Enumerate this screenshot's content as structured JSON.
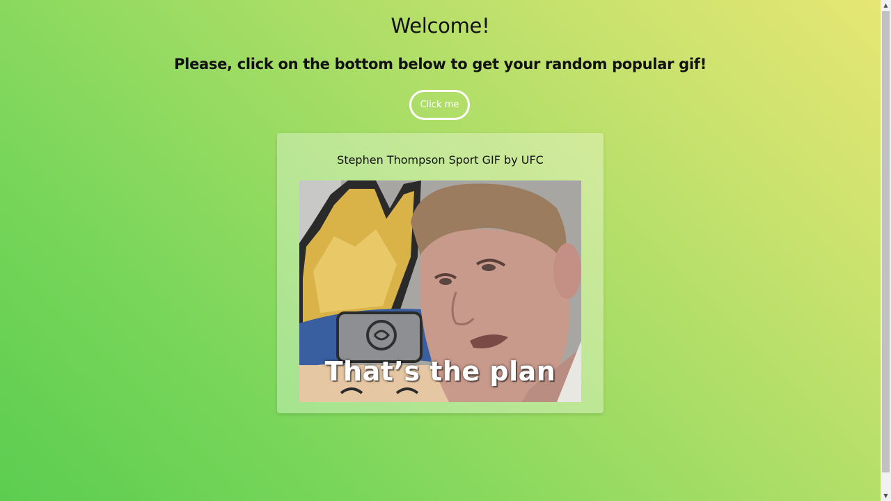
{
  "page": {
    "heading": "Welcome!",
    "subheading": "Please, click on the bottom below to get your random popular gif!",
    "button_label": "Click me"
  },
  "gif": {
    "title": "Stephen Thompson Sport GIF by UFC",
    "caption": "That’s the plan"
  },
  "scrollbar": {
    "up_icon": "chevron-up-icon",
    "down_icon": "chevron-down-icon"
  },
  "colors": {
    "gradient_top_right": "#e6e673",
    "gradient_bottom_left": "#5ccd50",
    "button_border": "#ffffff"
  }
}
